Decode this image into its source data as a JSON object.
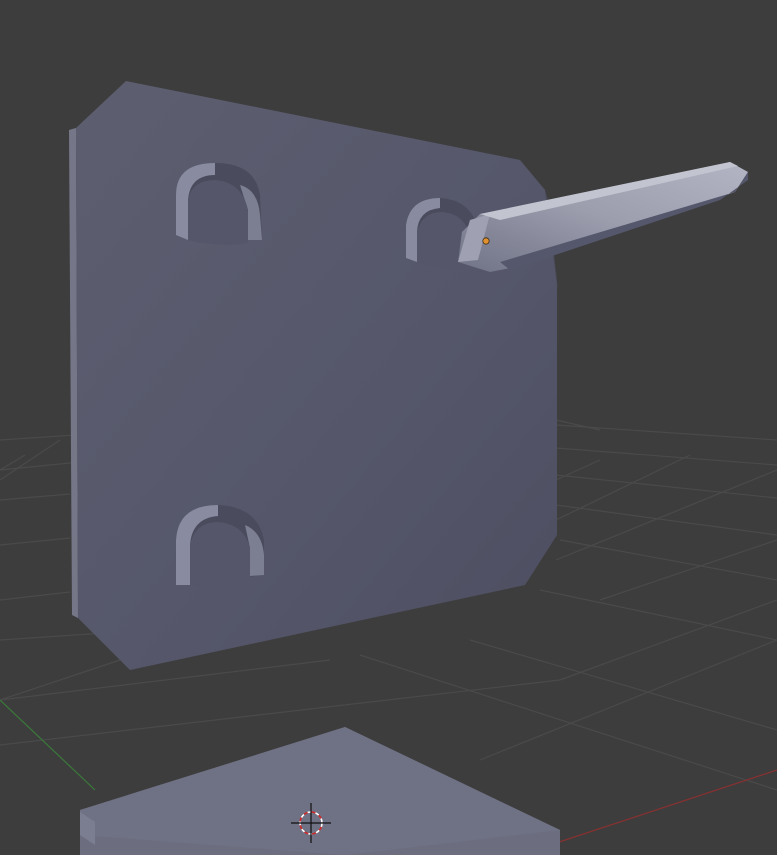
{
  "viewport": {
    "background": "#3d3d3d",
    "grid_color": "#4a4a4a",
    "axis_x_color": "#8a3030",
    "axis_y_color": "#3a7a3a"
  },
  "scene": {
    "objects": [
      {
        "name": "plate-with-slots",
        "color": "#5a5b6c",
        "selected": false
      },
      {
        "name": "angled-blade",
        "color": "#8c8e9e",
        "selected": true
      },
      {
        "name": "base-plate",
        "color": "#6c6e80",
        "selected": false
      }
    ],
    "origin_marker_color": "#e0902e",
    "cursor_icon": "3d-cursor-icon"
  }
}
